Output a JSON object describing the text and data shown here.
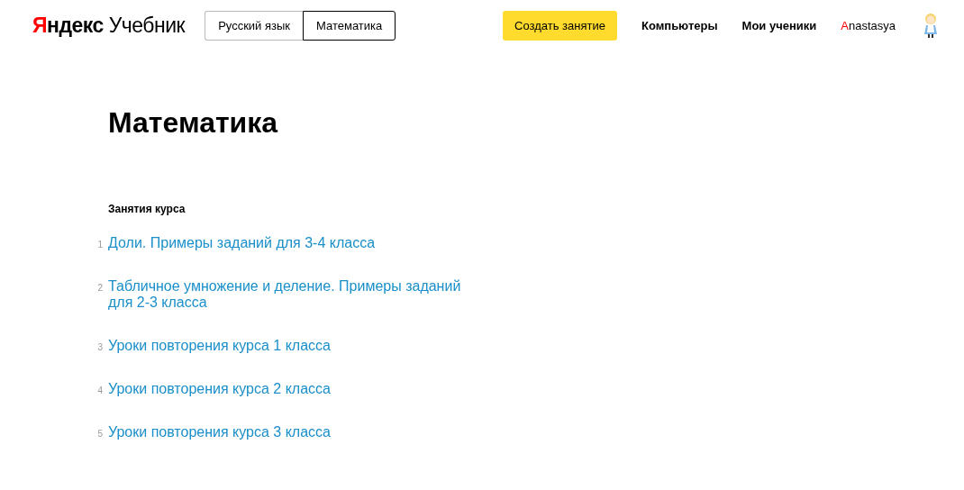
{
  "header": {
    "logo": {
      "brand": "Яндекс",
      "product": "Учебник"
    },
    "subject_tabs": [
      {
        "label": "Русский язык",
        "selected": false
      },
      {
        "label": "Математика",
        "selected": true
      }
    ],
    "create_button": "Создать занятие",
    "nav_links": [
      "Компьютеры",
      "Мои ученики"
    ],
    "user_name": "Anastasya"
  },
  "page_title": "Математика",
  "course": {
    "heading": "Занятия курса",
    "lessons": [
      {
        "number": "1",
        "title": "Доли. Примеры заданий для 3-4 класса"
      },
      {
        "number": "2",
        "title": "Табличное умножение и деление. Примеры заданий для 2-3 класса"
      },
      {
        "number": "3",
        "title": "Уроки повторения курса 1 класса"
      },
      {
        "number": "4",
        "title": "Уроки повторения курса 2 класса"
      },
      {
        "number": "5",
        "title": "Уроки повторения курса 3 класса"
      }
    ]
  }
}
